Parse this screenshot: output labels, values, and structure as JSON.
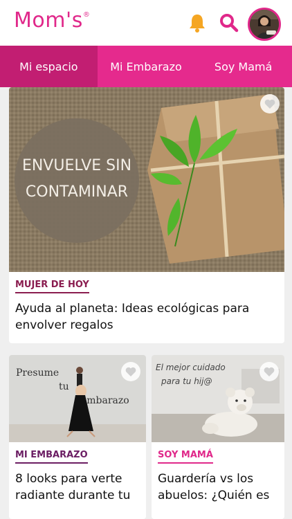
{
  "header": {
    "logo": "Mom's",
    "logo_mark": "®",
    "icons": [
      "bell-icon",
      "search-icon",
      "avatar"
    ]
  },
  "tabs": [
    {
      "label": "Mi espacio",
      "active": true
    },
    {
      "label": "Mi Embarazo",
      "active": false
    },
    {
      "label": "Soy Mamá",
      "active": false
    }
  ],
  "articles": [
    {
      "image_text_1": "ENVUELVE SIN",
      "image_text_2": "CONTAMINAR",
      "category": "MUJER DE HOY",
      "category_color": "#8a1c4f",
      "title": "Ayuda al planeta: Ideas ecológicas para envolver regalos"
    },
    {
      "image_text_1": "Presume",
      "image_text_2": "tu",
      "image_text_3": "embarazo",
      "category": "MI EMBARAZO",
      "category_color": "#6b1d63",
      "title": "8 looks para verte radiante durante tu"
    },
    {
      "image_text_1": "El mejor cuidado",
      "image_text_2": "para tu hij@",
      "category": "SOY MAMÁ",
      "category_color": "#e0288a",
      "title": "Guardería vs los abuelos: ¿Quién es"
    }
  ],
  "colors": {
    "brand": "#e0288a",
    "tab_bar": "#e52a8d",
    "tab_active": "#c21e72",
    "bell": "#f5a623"
  }
}
